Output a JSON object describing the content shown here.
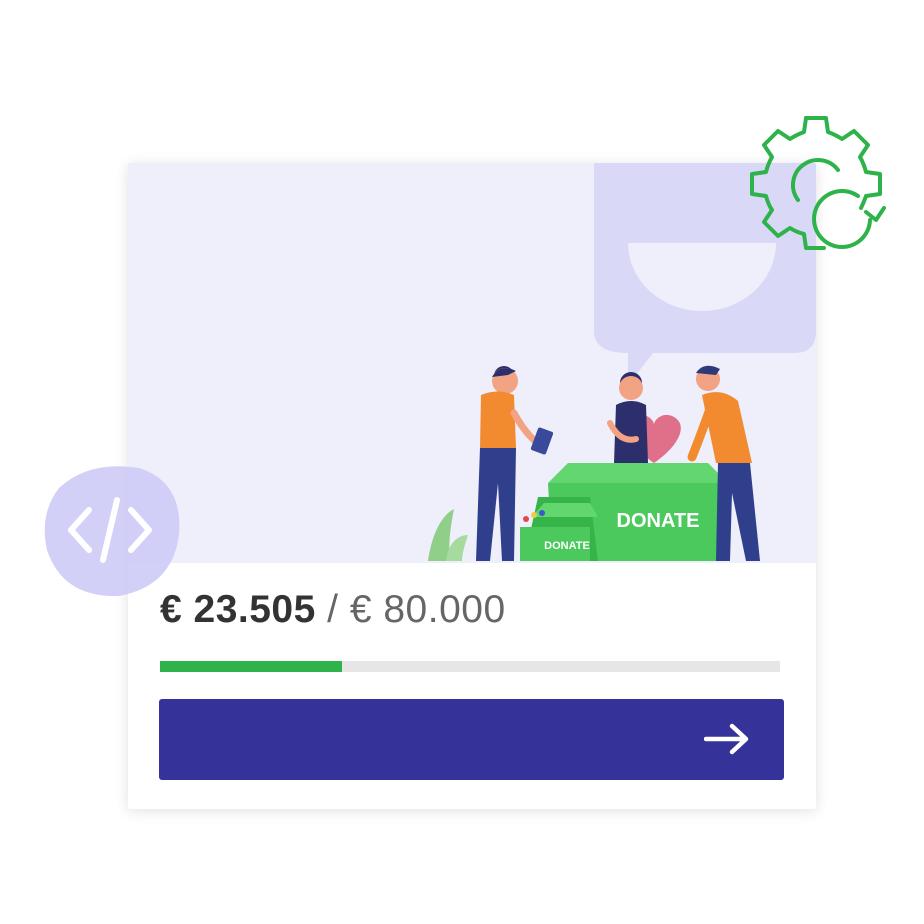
{
  "widget": {
    "raised": "€ 23.505",
    "separator": "/",
    "goal": "€ 80.000",
    "progress_fraction": 0.2938,
    "cta_icon": "arrow-right-icon"
  },
  "illustration": {
    "box_large_label": "DONATE",
    "box_small_label": "DONATE"
  },
  "badges": {
    "code_icon": "code-brackets-icon",
    "gear_icon": "gear-refresh-icon"
  },
  "colors": {
    "accent_green": "#2db34a",
    "button_blue": "#35339a",
    "hero_bg": "#efeefb",
    "bubble": "#d9d8f7",
    "track": "#e6e6e6"
  }
}
